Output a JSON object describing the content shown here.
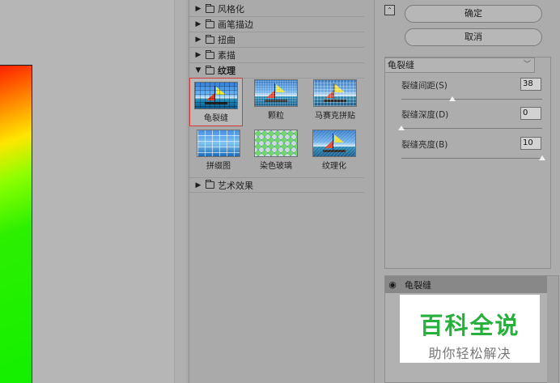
{
  "gallery": {
    "categories_top": [
      {
        "label": "风格化",
        "open": false
      },
      {
        "label": "画笔描边",
        "open": false
      },
      {
        "label": "扭曲",
        "open": false
      },
      {
        "label": "素描",
        "open": false
      },
      {
        "label": "纹理",
        "open": true
      }
    ],
    "texture_filters": [
      {
        "label": "龟裂缝",
        "selected": true
      },
      {
        "label": "颗粒",
        "selected": false
      },
      {
        "label": "马赛克拼贴",
        "selected": false
      },
      {
        "label": "拼缀图",
        "selected": false
      },
      {
        "label": "染色玻璃",
        "selected": false
      },
      {
        "label": "纹理化",
        "selected": false
      }
    ],
    "category_bottom": {
      "label": "艺术效果",
      "open": false
    },
    "collapsed_arrow": "▶",
    "expanded_arrow": "▼"
  },
  "panel": {
    "collapse_icon": "⌃",
    "ok_label": "确定",
    "cancel_label": "取消",
    "filter_select": "龟裂缝",
    "params": [
      {
        "label": "裂缝间距(S)",
        "value": "38",
        "fraction": 0.36
      },
      {
        "label": "裂缝深度(D)",
        "value": "0",
        "fraction": 0.0
      },
      {
        "label": "裂缝亮度(B)",
        "value": "10",
        "fraction": 1.0
      }
    ],
    "layer": {
      "eye_icon": "◉",
      "name": "龟裂缝"
    }
  },
  "watermark": {
    "title": "百科全说",
    "subtitle": "助你轻松解决"
  },
  "colors": {
    "selection": "#d53a3a",
    "watermark_green": "#27b03c",
    "panel_bg": "#acacac"
  }
}
